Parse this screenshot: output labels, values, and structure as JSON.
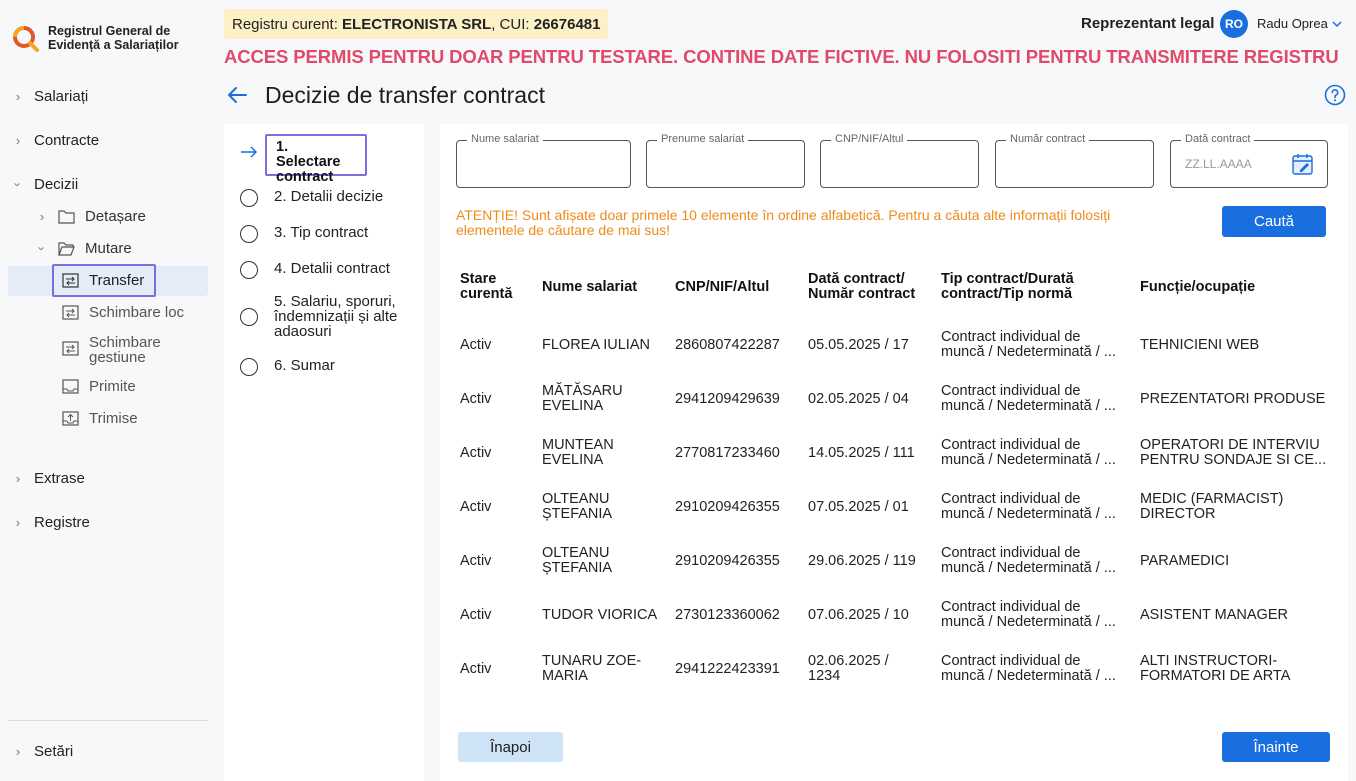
{
  "app": {
    "name": "Registrul General de Evidență a Salariaților"
  },
  "topbar": {
    "registry_prefix": "Registru curent: ",
    "registry_name": "ELECTRONISTA SRL",
    "cui_prefix": ", CUI: ",
    "cui": "26676481",
    "warning": "ACCES PERMIS PENTRU DOAR PENTRU TESTARE. CONTINE DATE FICTIVE. NU FOLOSITI PENTRU TRANSMITERE REGISTRU",
    "role": "Reprezentant legal",
    "avatar_initials": "RO",
    "user_name": "Radu Oprea"
  },
  "sidebar": {
    "salariati": "Salariați",
    "contracte": "Contracte",
    "decizii": "Decizii",
    "detasare": "Detașare",
    "mutare": "Mutare",
    "transfer": "Transfer",
    "schimbare_loc": "Schimbare loc",
    "schimbare_gestiune": "Schimbare gestiune",
    "primite": "Primite",
    "trimise": "Trimise",
    "extrase": "Extrase",
    "registre": "Registre",
    "setari": "Setări"
  },
  "page": {
    "title": "Decizie de transfer contract"
  },
  "steps": [
    {
      "label": "1. Selectare contract"
    },
    {
      "label": "2. Detalii decizie"
    },
    {
      "label": "3. Tip contract"
    },
    {
      "label": "4. Detalii contract"
    },
    {
      "label": "5. Salariu, sporuri, îndemnizații și alte adaosuri"
    },
    {
      "label": "6. Sumar"
    }
  ],
  "filters": {
    "nume": "Nume salariat",
    "prenume": "Prenume salariat",
    "cnp": "CNP/NIF/Altul",
    "numar_contract": "Număr contract",
    "data_contract": "Dată contract",
    "data_placeholder": "ZZ.LL.AAAA"
  },
  "attention": "ATENȚIE! Sunt afișate doar primele 10 elemente în ordine alfabetică. Pentru a căuta alte informații folosiți elementele de căutare de mai sus!",
  "buttons": {
    "search": "Caută",
    "back": "Înapoi",
    "next": "Înainte"
  },
  "table": {
    "headers": {
      "stare": "Stare curentă",
      "nume": "Nume salariat",
      "cnp": "CNP/NIF/Altul",
      "data": "Dată contract/ Număr contract",
      "tip": "Tip contract/Durată contract/Tip normă",
      "functie": "Funcție/ocupație"
    },
    "rows": [
      {
        "stare": "Activ",
        "nume": "FLOREA IULIAN",
        "cnp": "2860807422287",
        "data": "05.05.2025 / 17",
        "tip": "Contract individual de muncă / Nedeterminată / ...",
        "functie": "TEHNICIENI WEB"
      },
      {
        "stare": "Activ",
        "nume": "MĂTĂSARU EVELINA",
        "cnp": "2941209429639",
        "data": "02.05.2025 / 04",
        "tip": "Contract individual de muncă / Nedeterminată / ...",
        "functie": "PREZENTATORI PRODUSE"
      },
      {
        "stare": "Activ",
        "nume": "MUNTEAN EVELINA",
        "cnp": "2770817233460",
        "data": "14.05.2025 / 111",
        "tip": "Contract individual de muncă / Nedeterminată / ...",
        "functie": "OPERATORI DE INTERVIU PENTRU SONDAJE SI CE..."
      },
      {
        "stare": "Activ",
        "nume": "OLTEANU ȘTEFANIA",
        "cnp": "2910209426355",
        "data": "07.05.2025 / 01",
        "tip": "Contract individual de muncă / Nedeterminată / ...",
        "functie": "MEDIC (FARMACIST) DIRECTOR"
      },
      {
        "stare": "Activ",
        "nume": "OLTEANU ȘTEFANIA",
        "cnp": "2910209426355",
        "data": "29.06.2025 / 119",
        "tip": "Contract individual de muncă / Nedeterminată / ...",
        "functie": "PARAMEDICI"
      },
      {
        "stare": "Activ",
        "nume": "TUDOR VIORICA",
        "cnp": "2730123360062",
        "data": "07.06.2025 / 10",
        "tip": "Contract individual de muncă / Nedeterminată / ...",
        "functie": "ASISTENT MANAGER"
      },
      {
        "stare": "Activ",
        "nume": "TUNARU ZOE-MARIA",
        "cnp": "2941222423391",
        "data": "02.06.2025 / 1234",
        "tip": "Contract individual de muncă / Nedeterminată / ...",
        "functie": "ALTI INSTRUCTORI-FORMATORI DE ARTA"
      }
    ]
  },
  "colors": {
    "primary": "#1a6fe0",
    "warning": "#e04a6a",
    "attention": "#f08a1c",
    "focus": "#7b6fe0",
    "chip": "#fbf0c6"
  }
}
